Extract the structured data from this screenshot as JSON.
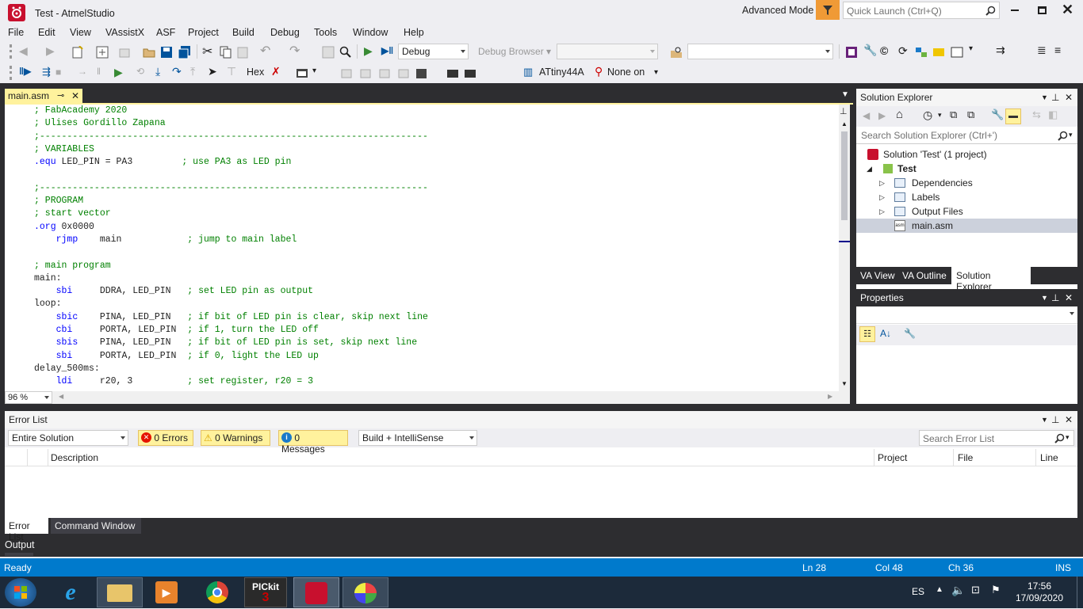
{
  "window": {
    "title": "Test - AtmelStudio",
    "advanced_mode": "Advanced Mode",
    "quick_launch": "Quick Launch (Ctrl+Q)"
  },
  "menu": [
    "File",
    "Edit",
    "View",
    "VAssistX",
    "ASF",
    "Project",
    "Build",
    "Debug",
    "Tools",
    "Window",
    "Help"
  ],
  "toolbar": {
    "config": "Debug",
    "debug_browser": "Debug Browser",
    "hex": "Hex",
    "device": "ATtiny44A",
    "tool": "None on"
  },
  "editor": {
    "tab": "main.asm",
    "zoom": "96 %",
    "lines": [
      [
        {
          "t": "; FabAcademy 2020",
          "c": "cm"
        }
      ],
      [
        {
          "t": "; Ulises Gordillo Zapana",
          "c": "cm"
        }
      ],
      [
        {
          "t": ";-----------------------------------------------------------------------",
          "c": "cm"
        }
      ],
      [
        {
          "t": "; VARIABLES",
          "c": "cm"
        }
      ],
      [
        {
          "t": ".equ",
          "c": "kw"
        },
        {
          "t": " LED_PIN = PA3         ",
          "c": ""
        },
        {
          "t": "; use PA3 as LED pin",
          "c": "cm"
        }
      ],
      [
        {
          "t": "",
          "c": ""
        }
      ],
      [
        {
          "t": ";-----------------------------------------------------------------------",
          "c": "cm"
        }
      ],
      [
        {
          "t": "; PROGRAM",
          "c": "cm"
        }
      ],
      [
        {
          "t": "; start vector",
          "c": "cm"
        }
      ],
      [
        {
          "t": ".org",
          "c": "kw"
        },
        {
          "t": " 0x0000",
          "c": ""
        }
      ],
      [
        {
          "t": "    ",
          "c": ""
        },
        {
          "t": "rjmp",
          "c": "kw"
        },
        {
          "t": "    main            ",
          "c": ""
        },
        {
          "t": "; jump to main label",
          "c": "cm"
        }
      ],
      [
        {
          "t": "",
          "c": ""
        }
      ],
      [
        {
          "t": "; main program",
          "c": "cm"
        }
      ],
      [
        {
          "t": "main:",
          "c": ""
        }
      ],
      [
        {
          "t": "    ",
          "c": ""
        },
        {
          "t": "sbi",
          "c": "kw"
        },
        {
          "t": "     DDRA, LED_PIN   ",
          "c": ""
        },
        {
          "t": "; set LED pin as output",
          "c": "cm"
        }
      ],
      [
        {
          "t": "loop:",
          "c": ""
        }
      ],
      [
        {
          "t": "    ",
          "c": ""
        },
        {
          "t": "sbic",
          "c": "kw"
        },
        {
          "t": "    PINA, LED_PIN   ",
          "c": ""
        },
        {
          "t": "; if bit of LED pin is clear, skip next line",
          "c": "cm"
        }
      ],
      [
        {
          "t": "    ",
          "c": ""
        },
        {
          "t": "cbi",
          "c": "kw"
        },
        {
          "t": "     PORTA, LED_PIN  ",
          "c": ""
        },
        {
          "t": "; if 1, turn the LED off",
          "c": "cm"
        }
      ],
      [
        {
          "t": "    ",
          "c": ""
        },
        {
          "t": "sbis",
          "c": "kw"
        },
        {
          "t": "    PINA, LED_PIN   ",
          "c": ""
        },
        {
          "t": "; if bit of LED pin is set, skip next line",
          "c": "cm"
        }
      ],
      [
        {
          "t": "    ",
          "c": ""
        },
        {
          "t": "sbi",
          "c": "kw"
        },
        {
          "t": "     PORTA, LED_PIN  ",
          "c": ""
        },
        {
          "t": "; if 0, light the LED up",
          "c": "cm"
        }
      ],
      [
        {
          "t": "delay_500ms:",
          "c": ""
        }
      ],
      [
        {
          "t": "    ",
          "c": ""
        },
        {
          "t": "ldi",
          "c": "kw"
        },
        {
          "t": "     r20, 3          ",
          "c": ""
        },
        {
          "t": "; set register, r20 = 3",
          "c": "cm"
        }
      ]
    ]
  },
  "solution_explorer": {
    "title": "Solution Explorer",
    "search": "Search Solution Explorer (Ctrl+')",
    "solution": "Solution 'Test' (1 project)",
    "project": "Test",
    "items": [
      "Dependencies",
      "Labels",
      "Output Files",
      "main.asm"
    ],
    "tabs": [
      "VA View",
      "VA Outline",
      "Solution Explorer"
    ]
  },
  "properties": {
    "title": "Properties"
  },
  "error_list": {
    "title": "Error List",
    "scope": "Entire Solution",
    "errors": "0 Errors",
    "warnings": "0 Warnings",
    "messages": "0 Messages",
    "filter": "Build + IntelliSense",
    "search": "Search Error List",
    "columns": [
      "Description",
      "Project",
      "File",
      "Line"
    ],
    "tabs": [
      "Error List",
      "Command Window"
    ]
  },
  "output": "Output",
  "status": {
    "ready": "Ready",
    "ln": "Ln 28",
    "col": "Col 48",
    "ch": "Ch 36",
    "ins": "INS"
  },
  "taskbar": {
    "lang": "ES",
    "time": "17:56",
    "date": "17/09/2020",
    "pickit": "PICkit"
  },
  "colors": {
    "accent": "#007acc",
    "title_bg": "#eeeef2",
    "panel_bg": "#2d2d30",
    "tab_active": "#fff29d"
  }
}
